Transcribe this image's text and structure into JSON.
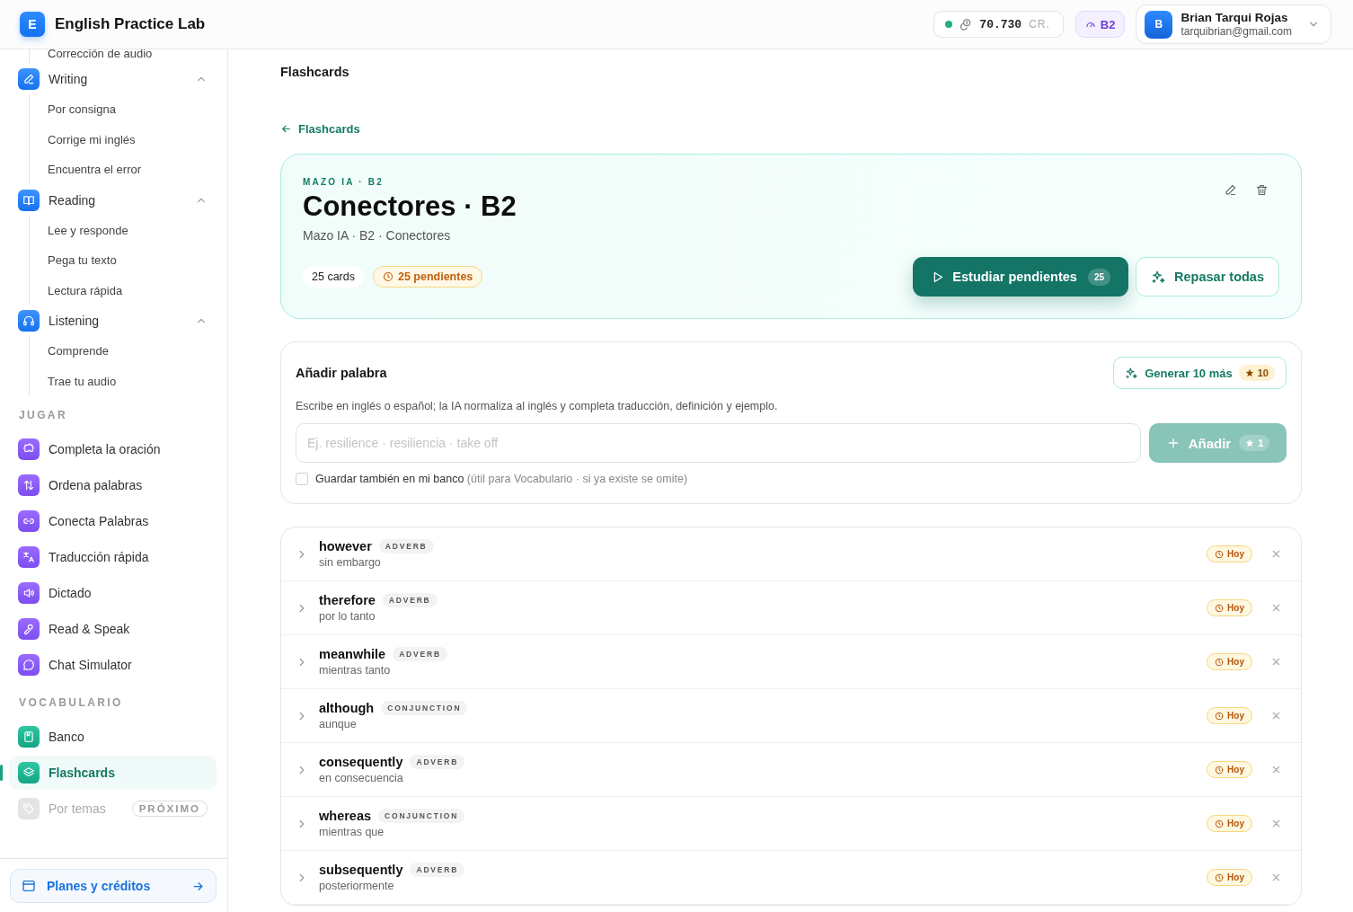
{
  "app": {
    "logo": "E",
    "name": "English Practice Lab"
  },
  "header": {
    "credits": {
      "online": true,
      "amount": "70.730",
      "unit": "CR."
    },
    "level": "B2",
    "user": {
      "initial": "B",
      "name": "Brian Tarqui Rojas",
      "email": "tarquibrian@gmail.com"
    }
  },
  "sidebar": {
    "partial_item": "Corrección de audio",
    "groups": [
      {
        "label": "Writing",
        "expanded": true,
        "children": [
          {
            "label": "Por consigna"
          },
          {
            "label": "Corrige mi inglés"
          },
          {
            "label": "Encuentra el error"
          }
        ]
      },
      {
        "label": "Reading",
        "expanded": true,
        "children": [
          {
            "label": "Lee y responde"
          },
          {
            "label": "Pega tu texto"
          },
          {
            "label": "Lectura rápida"
          }
        ]
      },
      {
        "label": "Listening",
        "expanded": true,
        "children": [
          {
            "label": "Comprende"
          },
          {
            "label": "Trae tu audio"
          }
        ]
      }
    ],
    "sections": [
      {
        "title": "JUGAR",
        "items": [
          {
            "label": "Completa la oración",
            "selected": false,
            "disabled": false
          },
          {
            "label": "Ordena palabras",
            "selected": false,
            "disabled": false
          },
          {
            "label": "Conecta Palabras",
            "selected": false,
            "disabled": false
          },
          {
            "label": "Traducción rápida",
            "selected": false,
            "disabled": false
          },
          {
            "label": "Dictado",
            "selected": false,
            "disabled": false
          },
          {
            "label": "Read & Speak",
            "selected": false,
            "disabled": false
          },
          {
            "label": "Chat Simulator",
            "selected": false,
            "disabled": false
          }
        ]
      },
      {
        "title": "VOCABULARIO",
        "items": [
          {
            "label": "Banco",
            "selected": false,
            "disabled": false
          },
          {
            "label": "Flashcards",
            "selected": true,
            "disabled": false
          },
          {
            "label": "Por temas",
            "selected": false,
            "disabled": true,
            "badge": "PRÓXIMO"
          }
        ]
      }
    ],
    "plans_button": "Planes y créditos"
  },
  "main": {
    "page_title": "Flashcards",
    "back_link": "Flashcards",
    "deck": {
      "eyebrow": "MAZO IA · B2",
      "title": "Conectores · B2",
      "subtitle": "Mazo IA · B2 · Conectores",
      "count": "25 cards",
      "pending": "25 pendientes",
      "study_button": {
        "label": "Estudiar pendientes",
        "count": "25"
      },
      "review_button": "Repasar todas"
    },
    "add_word": {
      "title": "Añadir palabra",
      "generate_button": {
        "label": "Generar 10 más",
        "cost": "10"
      },
      "hint": "Escribe en inglés o español; la IA normaliza al inglés y completa traducción, definición y ejemplo.",
      "input": {
        "placeholder": "Ej. resilience · resiliencia · take off"
      },
      "add_button": {
        "label": "Añadir",
        "cost": "1",
        "disabled": true
      },
      "save_to_bank": {
        "label": "Guardar también en mi banco",
        "note": "(útil para Vocabulario · si ya existe se omite)",
        "checked": false
      }
    },
    "cards": [
      {
        "word": "however",
        "pos": "ADVERB",
        "translation": "sin embargo",
        "due": "Hoy",
        "expanded": false
      },
      {
        "word": "therefore",
        "pos": "ADVERB",
        "translation": "por lo tanto",
        "due": "Hoy",
        "expanded": false
      },
      {
        "word": "meanwhile",
        "pos": "ADVERB",
        "translation": "mientras tanto",
        "due": "Hoy",
        "expanded": false
      },
      {
        "word": "although",
        "pos": "CONJUNCTION",
        "translation": "aunque",
        "due": "Hoy",
        "expanded": false
      },
      {
        "word": "consequently",
        "pos": "ADVERB",
        "translation": "en consecuencia",
        "due": "Hoy",
        "expanded": false
      },
      {
        "word": "whereas",
        "pos": "CONJUNCTION",
        "translation": "mientras que",
        "due": "Hoy",
        "expanded": false
      },
      {
        "word": "subsequently",
        "pos": "ADVERB",
        "translation": "posteriormente",
        "due": "Hoy",
        "expanded": false
      }
    ]
  }
}
